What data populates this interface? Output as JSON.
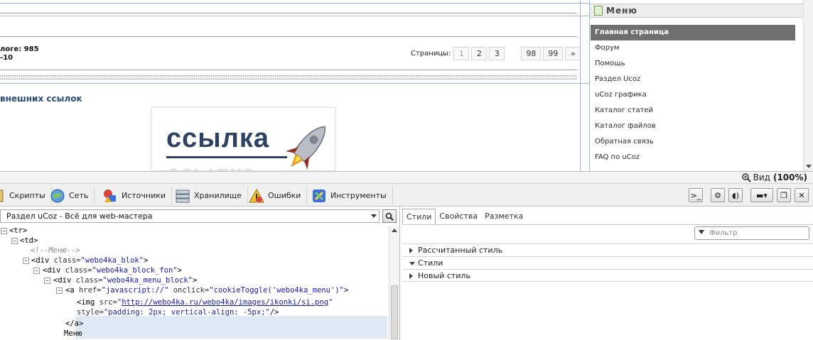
{
  "page": {
    "catalog_line1": "логе: 985",
    "catalog_line2": "-10",
    "pager_label": "Страницы:",
    "pages": [
      "1",
      "2",
      "3",
      "98",
      "99",
      "»"
    ],
    "section_title": "внешних ссылок",
    "banner_word": "ссылка"
  },
  "menu": {
    "title": "Меню",
    "items": [
      "Главная страница",
      "Форум",
      "Помощь",
      "Раздел Ucoz",
      "uCoz графика",
      "Каталог статей",
      "Каталог файлов",
      "Обратная связь",
      "FAQ по uCoz"
    ]
  },
  "devtools": {
    "zoom_label": "Вид",
    "zoom_value": "(100%)",
    "toolbar": [
      "Скрипты",
      "Сеть",
      "Источники",
      "Хранилище",
      "Ошибки",
      "Инструменты"
    ],
    "frame_select": "Раздел uCoz - Всё для web-мастера",
    "tree": {
      "r0": "<tr>",
      "r1": "<td>",
      "r2": "<!--Меню-->",
      "r3_tag": "<div ",
      "r3_attr": "class=",
      "r3_val": "\"webo4ka_blok\"",
      "r3_end": ">",
      "r4_tag": "<div ",
      "r4_attr": "class=",
      "r4_val": "\"webo4ka_block_fon\"",
      "r4_end": ">",
      "r5_tag": "<div ",
      "r5_attr": "class=",
      "r5_val": "\"webo4ka_menu_block\"",
      "r5_end": ">",
      "r6_tag": "<a ",
      "r6_attr1": "href=",
      "r6_val1": "\"javascript://\"",
      "r6_attr2": " onclick=",
      "r6_val2": "\"cookieToggle('webo4ka_menu')\"",
      "r6_end": ">",
      "r7_tag": "<img ",
      "r7_attr": "src=",
      "r7_q1": "\"",
      "r7_url": "http://webo4ka.ru/webo4ka/images/ikonki/si.png",
      "r7_q2": "\"",
      "r8_attr": "style=",
      "r8_val": "\"padding: 2px; vertical-align: -5px;\"",
      "r8_end": "/>",
      "r9": "</a>",
      "r10": "Меню"
    },
    "side_tabs": [
      "Стили",
      "Свойства",
      "Разметка"
    ],
    "filter_placeholder": "Фильтр",
    "sections": [
      "Рассчитанный стиль",
      "Стили",
      "Новый стиль"
    ]
  }
}
